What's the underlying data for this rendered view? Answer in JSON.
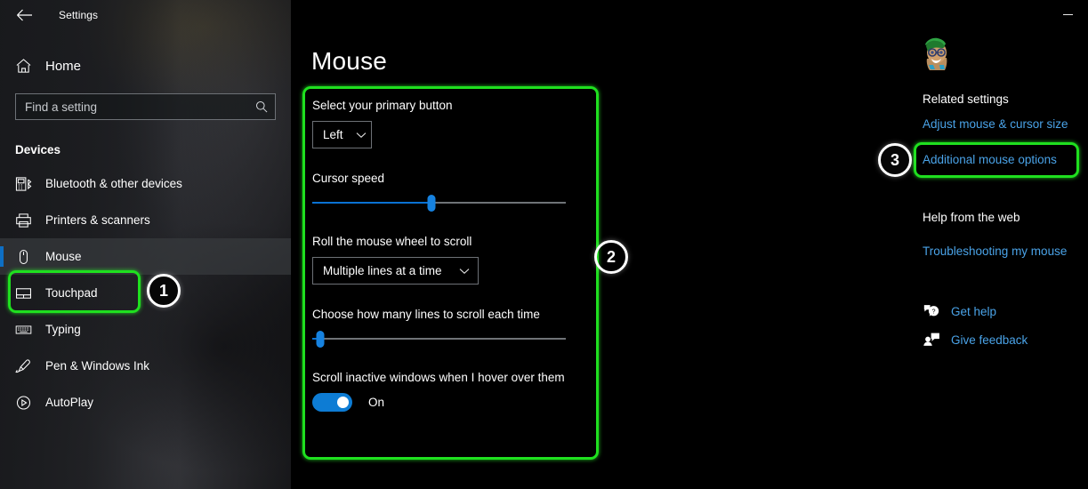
{
  "window": {
    "title": "Settings",
    "back_icon": "back-arrow-icon",
    "minimize_icon": "minimize-icon"
  },
  "sidebar": {
    "home": {
      "label": "Home",
      "icon": "home-icon"
    },
    "search": {
      "value": "",
      "placeholder": "Find a setting",
      "icon": "search-icon"
    },
    "section_title": "Devices",
    "items": [
      {
        "label": "Bluetooth & other devices",
        "icon": "bluetooth-devices-icon",
        "selected": false
      },
      {
        "label": "Printers & scanners",
        "icon": "printer-icon",
        "selected": false
      },
      {
        "label": "Mouse",
        "icon": "mouse-icon",
        "selected": true
      },
      {
        "label": "Touchpad",
        "icon": "touchpad-icon",
        "selected": false
      },
      {
        "label": "Typing",
        "icon": "keyboard-icon",
        "selected": false
      },
      {
        "label": "Pen & Windows Ink",
        "icon": "pen-icon",
        "selected": false
      },
      {
        "label": "AutoPlay",
        "icon": "autoplay-icon",
        "selected": false
      }
    ]
  },
  "main": {
    "page_title": "Mouse",
    "primary_button": {
      "label": "Select your primary button",
      "value": "Left",
      "chevron_icon": "chevron-down-icon"
    },
    "cursor_speed": {
      "label": "Cursor speed",
      "percent": 47
    },
    "wheel_scroll": {
      "label": "Roll the mouse wheel to scroll",
      "value": "Multiple lines at a time",
      "chevron_icon": "chevron-down-icon"
    },
    "lines_to_scroll": {
      "label": "Choose how many lines to scroll each time",
      "percent": 3
    },
    "inactive_scroll": {
      "label": "Scroll inactive windows when I hover over them",
      "state": "On"
    }
  },
  "right_rail": {
    "avatar_icon": "user-avatar-image",
    "related_settings_title": "Related settings",
    "links": [
      {
        "label": "Adjust mouse & cursor size"
      },
      {
        "label": "Additional mouse options"
      }
    ],
    "help_title": "Help from the web",
    "help_link": "Troubleshooting my mouse",
    "support": [
      {
        "label": "Get help",
        "icon": "question-bubble-icon"
      },
      {
        "label": "Give feedback",
        "icon": "feedback-person-icon"
      }
    ]
  },
  "annotations": {
    "highlight_color": "#1fe01f",
    "badges": [
      {
        "number": "1",
        "target": "sidebar-item-mouse"
      },
      {
        "number": "2",
        "target": "mouse-settings-panel"
      },
      {
        "number": "3",
        "target": "additional-mouse-options-link"
      }
    ]
  },
  "colors": {
    "accent_blue": "#0d7cd4",
    "link_blue": "#4aa3e8",
    "highlight_green": "#1fe01f",
    "background": "#000000"
  }
}
